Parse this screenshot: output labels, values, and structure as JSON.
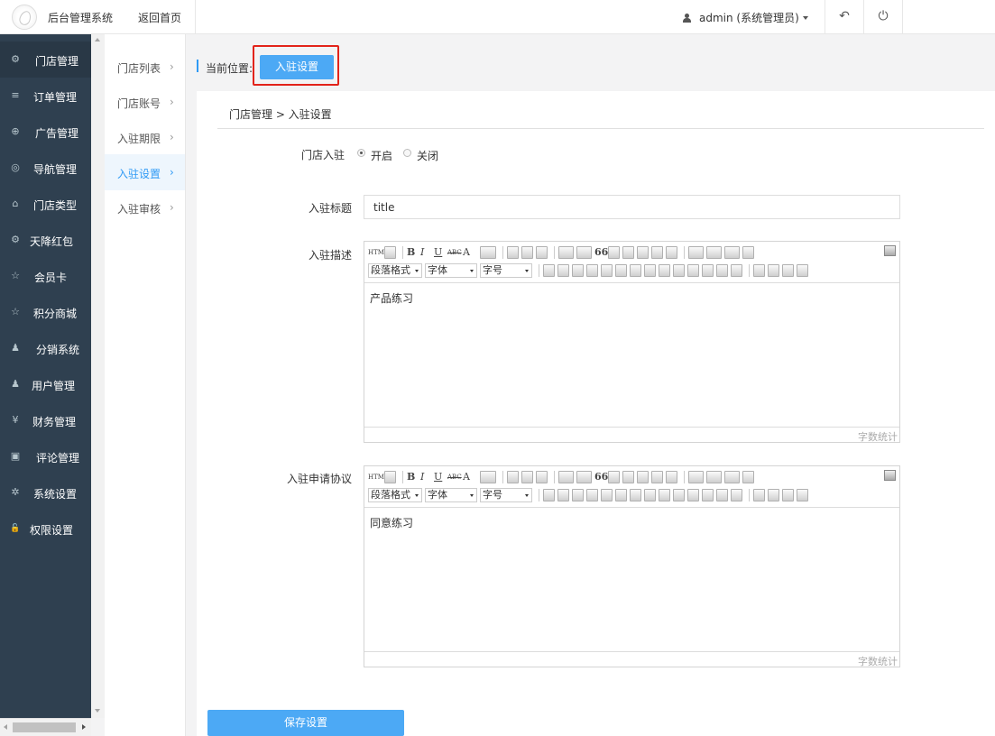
{
  "header": {
    "app_title": "后台管理系统",
    "home_link": "返回首页",
    "user": "admin (系统管理员)",
    "icons": [
      "user-icon",
      "caret-down-icon",
      "undo-icon",
      "power-icon"
    ]
  },
  "sidebar": {
    "items": [
      {
        "label": "门店管理",
        "icon": "store-icon",
        "glyph": "⚙"
      },
      {
        "label": "订单管理",
        "icon": "list-icon",
        "glyph": "≡"
      },
      {
        "label": "广告管理",
        "icon": "globe-icon",
        "glyph": "⊕"
      },
      {
        "label": "导航管理",
        "icon": "compass-icon",
        "glyph": "◎"
      },
      {
        "label": "门店类型",
        "icon": "bank-icon",
        "glyph": "⌂"
      },
      {
        "label": "天降红包",
        "icon": "gears-icon",
        "glyph": "⚙"
      },
      {
        "label": "会员卡",
        "icon": "star-icon",
        "glyph": "☆"
      },
      {
        "label": "积分商城",
        "icon": "star-icon",
        "glyph": "☆"
      },
      {
        "label": "分销系统",
        "icon": "users-icon",
        "glyph": "♟"
      },
      {
        "label": "用户管理",
        "icon": "user-icon",
        "glyph": "♟"
      },
      {
        "label": "财务管理",
        "icon": "yen-icon",
        "glyph": "¥"
      },
      {
        "label": "评论管理",
        "icon": "money-icon",
        "glyph": "▣"
      },
      {
        "label": "系统设置",
        "icon": "gear-icon",
        "glyph": "✲"
      },
      {
        "label": "权限设置",
        "icon": "lock-icon",
        "glyph": "🔓"
      }
    ],
    "active_index": 0
  },
  "subnav": {
    "items": [
      {
        "label": "门店列表",
        "chevron": "›"
      },
      {
        "label": "门店账号",
        "chevron": "›"
      },
      {
        "label": "入驻期限",
        "chevron": "›"
      },
      {
        "label": "入驻设置",
        "chevron": "›"
      },
      {
        "label": "入驻审核",
        "chevron": "›"
      }
    ],
    "active_index": 3
  },
  "location": {
    "label": "当前位置:",
    "current": "入驻设置"
  },
  "breadcrumb": "门店管理 > 入驻设置",
  "form": {
    "enable_label": "门店入驻",
    "enable_options": [
      "开启",
      "关闭"
    ],
    "enable_selected": "开启",
    "title_label": "入驻标题",
    "title_value": "title",
    "desc_label": "入驻描述",
    "desc_content": "产品练习",
    "agreement_label": "入驻申请协议",
    "agreement_content": "同意练习",
    "word_count_label": "字数统计",
    "save_label": "保存设置"
  },
  "editor_toolbar": {
    "paragraph_select": "段落格式",
    "font_select": "字体",
    "size_select": "字号",
    "html_label": "HTML",
    "bold": "B",
    "italic": "I",
    "underline": "U",
    "strike": "ABC",
    "font_color": "A",
    "quote": "66"
  },
  "colors": {
    "accent": "#4ca9f5",
    "sidebar_bg": "#2f4050",
    "highlight_frame": "#e2231a"
  }
}
